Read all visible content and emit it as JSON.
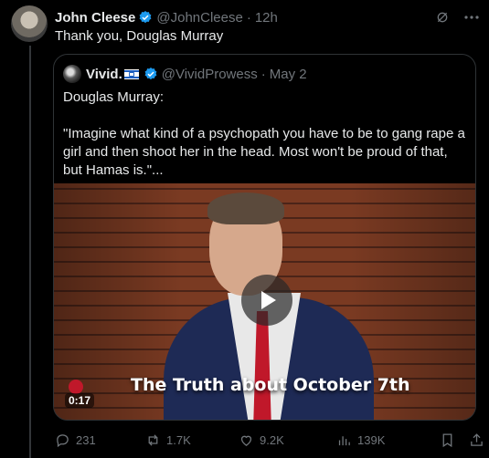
{
  "tweet": {
    "display_name": "John Cleese",
    "handle": "@JohnCleese",
    "separator": "·",
    "time": "12h",
    "text": "Thank you, Douglas Murray"
  },
  "quote": {
    "display_name": "Vivid.",
    "handle": "@VividProwess",
    "separator": "·",
    "date": "May 2",
    "body": "Douglas Murray:\n\n\"Imagine what kind of a psychopath you have to be to gang rape a girl and then shoot her in the head. Most won't be proud of that, but Hamas is.\"...",
    "video": {
      "caption": "The Truth about October 7th",
      "duration": "0:17"
    }
  },
  "actions": {
    "replies": "231",
    "reposts": "1.7K",
    "likes": "9.2K",
    "views": "139K"
  },
  "colors": {
    "background": "#000000",
    "text": "#e7e9ea",
    "muted": "#71767b",
    "verified": "#1d9bf0",
    "border": "#2f3336"
  }
}
